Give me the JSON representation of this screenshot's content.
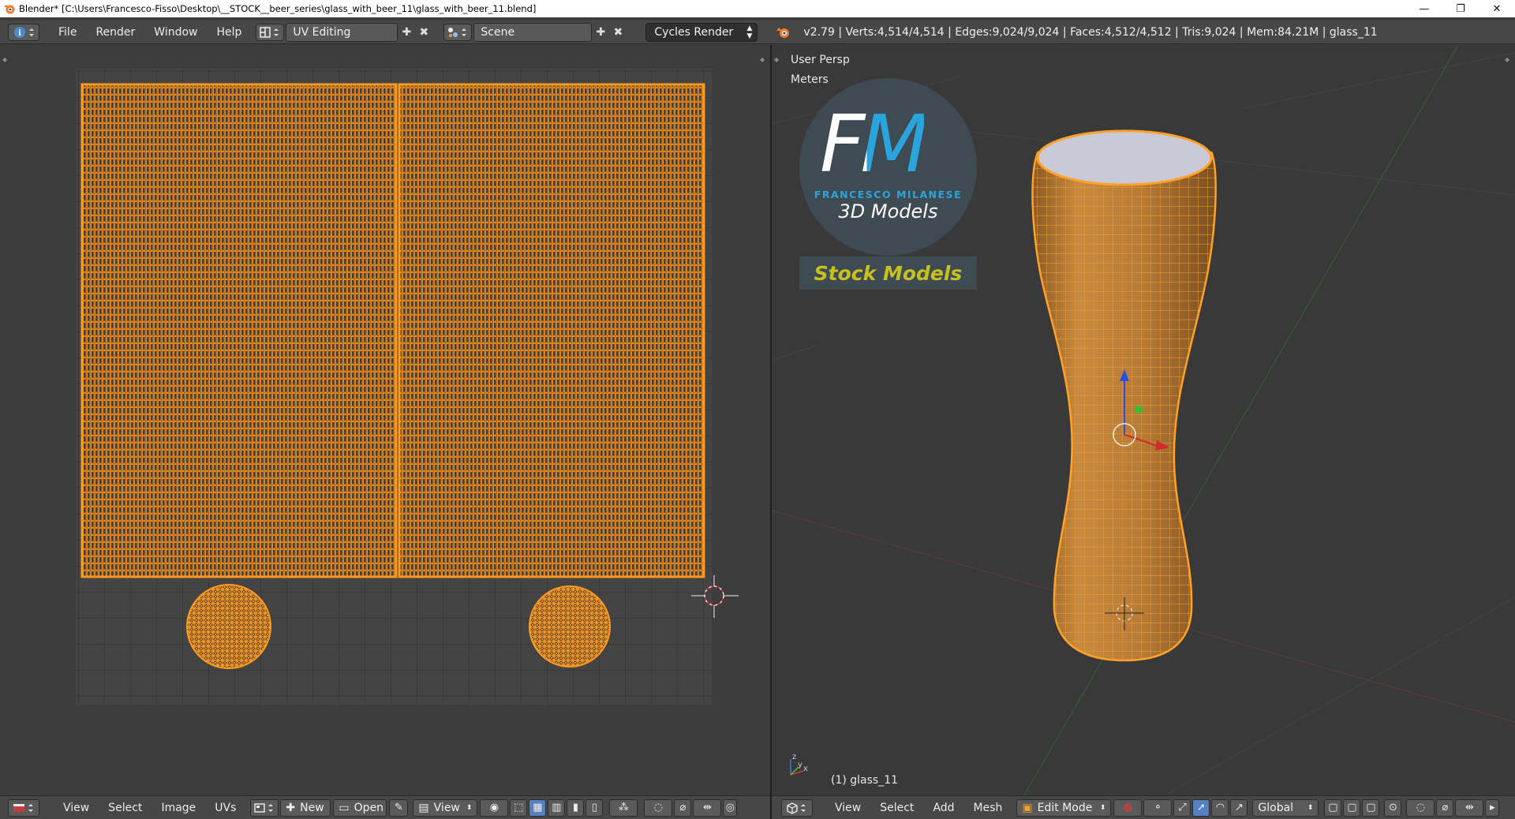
{
  "window": {
    "title": "Blender* [C:\\Users\\Francesco-Fisso\\Desktop\\__STOCK__beer_series\\glass_with_beer_11\\glass_with_beer_11.blend]",
    "controls": {
      "minimize": "—",
      "maximize": "❐",
      "close": "✕"
    }
  },
  "topbar": {
    "menus": [
      "File",
      "Render",
      "Window",
      "Help"
    ],
    "screen_layout": "UV Editing",
    "scene": "Scene",
    "render_engine": "Cycles Render",
    "stats": "v2.79 | Verts:4,514/4,514 | Edges:9,024/9,024 | Faces:4,512/4,512 | Tris:9,024 | Mem:84.21M | glass_11"
  },
  "uv_editor": {
    "menus": [
      "View",
      "Select",
      "Image",
      "UVs"
    ],
    "new_label": "New",
    "open_label": "Open",
    "view_label": "View"
  },
  "viewport": {
    "view_name": "User Persp",
    "units": "Meters",
    "object_label": "(1) glass_11",
    "menus": [
      "View",
      "Select",
      "Add",
      "Mesh"
    ],
    "mode": "Edit Mode",
    "orientation": "Global"
  },
  "watermark": {
    "logo_letters": "FM",
    "brand": "FRANCESCO MILANESE",
    "tagline": "3D Models",
    "banner": "Stock Models"
  },
  "colors": {
    "accent_orange": "#f08c1a",
    "brand_blue": "#2aa4dc",
    "banner_yellow": "#c8c01e"
  }
}
